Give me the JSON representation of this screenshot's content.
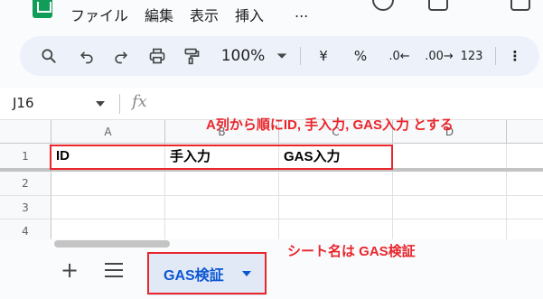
{
  "menu": {
    "items": [
      "ファイル",
      "編集",
      "表示",
      "挿入"
    ],
    "more": "..."
  },
  "toolbar": {
    "zoom": "100%",
    "currency": "¥",
    "percent": "%",
    "decrease_decimals": ".0←",
    "increase_decimals": ".00→",
    "number_format": "123",
    "more": "⋮"
  },
  "formula_bar": {
    "name_box": "J16",
    "fx": "fx",
    "value": ""
  },
  "columns": [
    "A",
    "B",
    "C",
    "D"
  ],
  "rows": [
    {
      "number": "1",
      "cells": [
        "ID",
        "手入力",
        "GAS入力",
        ""
      ]
    },
    {
      "number": "2",
      "cells": [
        "",
        "",
        "",
        ""
      ]
    },
    {
      "number": "3",
      "cells": [
        "",
        "",
        "",
        ""
      ]
    },
    {
      "number": "4",
      "cells": [
        "",
        "",
        "",
        ""
      ]
    }
  ],
  "annotations": {
    "header_note": "A列から順にID, 手入力, GAS入力 とする",
    "sheet_note": "シート名は GAS検証",
    "color": "#e8262c"
  },
  "sheet_bar": {
    "add": "+",
    "active_sheet": "GAS検証"
  }
}
